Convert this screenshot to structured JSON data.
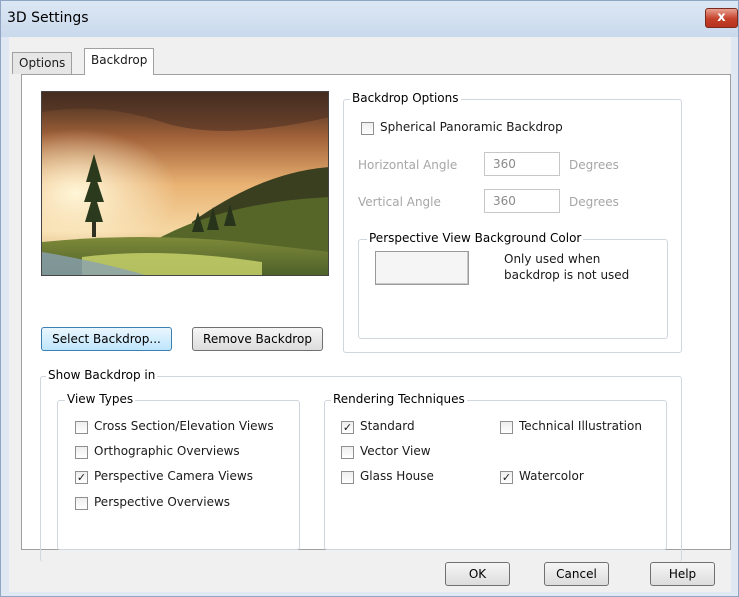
{
  "window": {
    "title": "3D Settings",
    "close_label": "x"
  },
  "tabs": [
    {
      "label": "Options"
    },
    {
      "label": "Backdrop"
    }
  ],
  "buttons": {
    "select_backdrop": "Select Backdrop...",
    "remove_backdrop": "Remove Backdrop"
  },
  "backdrop_options": {
    "title": "Backdrop Options",
    "spherical_label": "Spherical Panoramic Backdrop",
    "spherical_checked": false,
    "horizontal_label": "Horizontal Angle",
    "horizontal_value": "360",
    "horizontal_unit": "Degrees",
    "vertical_label": "Vertical Angle",
    "vertical_value": "360",
    "vertical_unit": "Degrees",
    "bg_color_title": "Perspective View Background Color",
    "bg_note_line1": "Only used when",
    "bg_note_line2": "backdrop is not used"
  },
  "show_backdrop": {
    "title": "Show Backdrop in",
    "view_types": {
      "title": "View Types",
      "items": [
        {
          "label": "Cross Section/Elevation Views",
          "checked": false
        },
        {
          "label": "Orthographic Overviews",
          "checked": false
        },
        {
          "label": "Perspective Camera Views",
          "checked": true
        },
        {
          "label": "Perspective Overviews",
          "checked": false
        }
      ]
    },
    "rendering": {
      "title": "Rendering Techniques",
      "items": [
        {
          "label": "Standard",
          "checked": true
        },
        {
          "label": "Technical Illustration",
          "checked": false
        },
        {
          "label": "Vector View",
          "checked": false
        },
        {
          "label": "Glass House",
          "checked": false
        },
        {
          "label": "Watercolor",
          "checked": true
        }
      ]
    }
  },
  "footer": {
    "ok": "OK",
    "cancel": "Cancel",
    "help": "Help"
  },
  "colors": {
    "accent": "#3c7fb1",
    "title_bar": "#c9d9ec",
    "close": "#c4402a"
  }
}
